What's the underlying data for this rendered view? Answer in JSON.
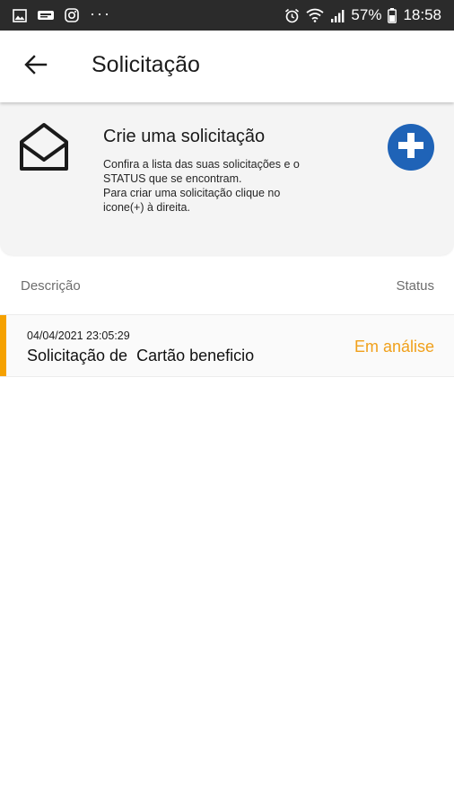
{
  "status_bar": {
    "battery": "57%",
    "time": "18:58",
    "dots": "···",
    "left_icons": [
      "gallery-icon",
      "brand-app-icon",
      "instagram-icon"
    ],
    "right_icons": [
      "alarm-icon",
      "wifi-icon",
      "signal-icon",
      "battery-icon"
    ]
  },
  "app_bar": {
    "title": "Solicitação",
    "back_icon": "arrow-left-icon"
  },
  "info_card": {
    "icon": "open-envelope-icon",
    "title": "Crie uma solicitação",
    "description": "Confira a lista das suas solicitações e o\nSTATUS que se encontram.\nPara criar uma solicitação clique no\nicone(+) à direita.",
    "add_icon": "plus-circle-icon",
    "add_color": "#1f63b7"
  },
  "list": {
    "headers": {
      "description": "Descrição",
      "status": "Status"
    },
    "rows": [
      {
        "date": "04/04/2021 23:05:29",
        "title": "Solicitação de  Cartão beneficio",
        "status": "Em análise",
        "accent_color": "#f5a100",
        "status_color": "#f0a01b"
      }
    ]
  }
}
